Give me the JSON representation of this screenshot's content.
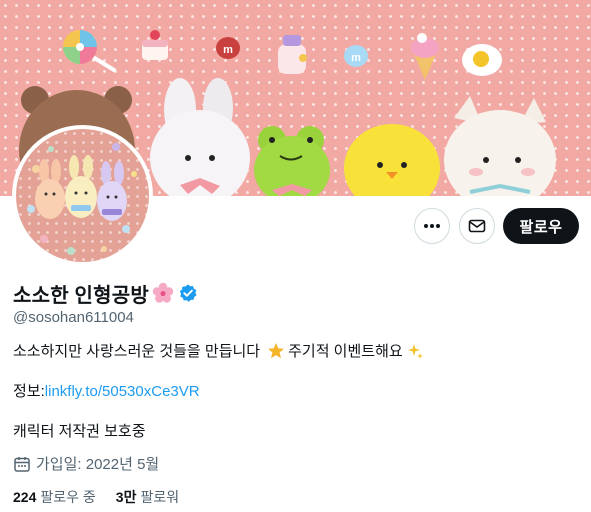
{
  "profile": {
    "display_name": "소소한 인형공방",
    "name_emoji": "cherry-blossom-icon",
    "verified": true,
    "handle": "@sosohan611004",
    "bio_part1": "소소하지만 사랑스러운 것들을 만듭니다",
    "bio_part2": "주기적 이벤트해요",
    "bio_emoji_1": "star-icon",
    "bio_emoji_2": "sparkles-icon",
    "info_label": "정보:",
    "info_link": "linkfly.to/50530xCe3VR",
    "extra_line": "캐릭터 저작권 보호중",
    "joined": "가입일: 2022년 5월"
  },
  "stats": {
    "following_count": "224",
    "following_label": "팔로우 중",
    "followers_count": "3만",
    "followers_label": "팔로워"
  },
  "actions": {
    "follow_label": "팔로우",
    "more_icon": "more-icon",
    "message_icon": "mail-icon"
  },
  "colors": {
    "accent": "#1d9bf0",
    "follow_button": "#0f1419",
    "banner_pink": "#f2a9a3",
    "secondary_text": "#536471"
  }
}
